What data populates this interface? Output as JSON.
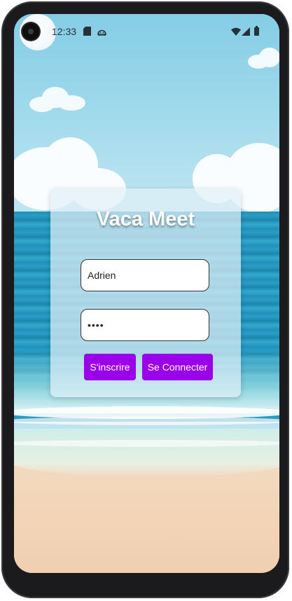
{
  "status_bar": {
    "time": "12:33",
    "left_icons": [
      "sd-card-icon",
      "android-icon"
    ],
    "right_icons": [
      "wifi-icon",
      "signal-icon",
      "battery-icon"
    ]
  },
  "app": {
    "title": "Vaca Meet",
    "username_value": "Adrien",
    "password_value": "••••",
    "signup_label": "S'inscrire",
    "login_label": "Se Connecter"
  },
  "colors": {
    "accent": "#9b00ea",
    "title_text": "#ffffff"
  }
}
